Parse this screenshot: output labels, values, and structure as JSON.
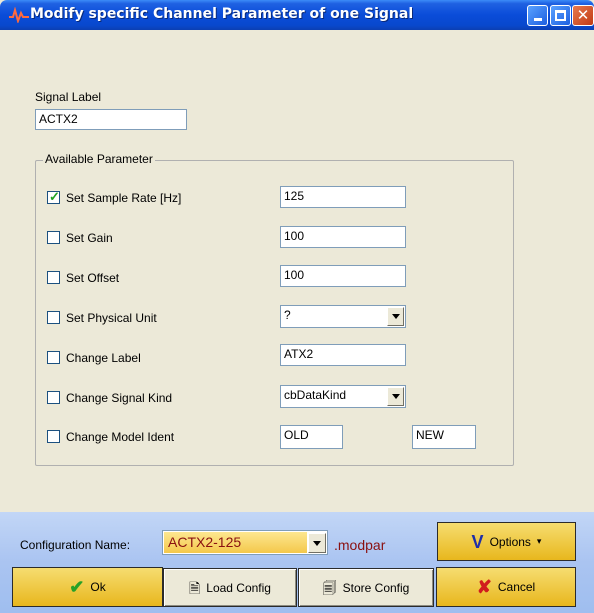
{
  "window": {
    "title": "Modify specific Channel Parameter of one Signal"
  },
  "signal": {
    "label": "Signal Label",
    "value": "ACTX2"
  },
  "group": {
    "title": "Available Parameter",
    "rows": [
      {
        "label": "Set Sample Rate [Hz]",
        "checked": true,
        "value": "125"
      },
      {
        "label": "Set Gain",
        "checked": false,
        "value": "100"
      },
      {
        "label": "Set Offset",
        "checked": false,
        "value": "100"
      },
      {
        "label": "Set Physical Unit",
        "checked": false,
        "value": "?"
      },
      {
        "label": "Change Label",
        "checked": false,
        "value": "ATX2"
      },
      {
        "label": "Change Signal Kind",
        "checked": false,
        "value": "cbDataKind"
      },
      {
        "label": "Change Model Ident",
        "checked": false,
        "old": "OLD",
        "new": "NEW"
      }
    ]
  },
  "config": {
    "label": "Configuration Name:",
    "value": "ACTX2-125",
    "extension": ".modpar"
  },
  "buttons": {
    "options": "Options",
    "ok": "Ok",
    "load": "Load Config",
    "store": "Store Config",
    "cancel": "Cancel"
  },
  "icons": {
    "title": "signal-wave-icon",
    "ok": "checkmark-icon",
    "cancel": "x-icon",
    "options": "v-icon",
    "load": "load-file-icon",
    "store": "store-file-icon"
  },
  "colors": {
    "title_bar": "#0a4cd9",
    "accent_gold": "#e8b71d",
    "config_text": "#8a1010",
    "bottom_bar": "#aac4f1"
  }
}
